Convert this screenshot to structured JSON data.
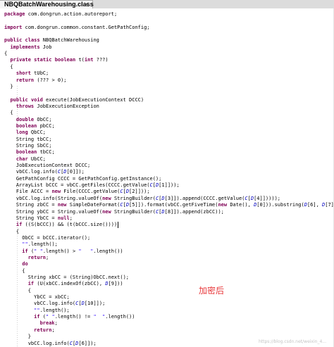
{
  "tab": {
    "title": "NBQBatchWarehousing.class",
    "close": "✕"
  },
  "code_lines": [
    "package com.dongrun.action.autoreport;",
    "",
    "import com.dongrun.common.constant.GetPathConfig;",
    "",
    "public class NBQBatchWarehousing",
    "  implements Job",
    "{",
    "  private static boolean t(int ???)",
    "  {",
    "    short tUbC;",
    "    return (??? > 0);",
    "  }",
    "",
    "  public void execute(JobExecutionContext DCCC)",
    "    throws JobExecutionException",
    "  {",
    "    double ObCC;",
    "    boolean pbCC;",
    "    long QbCC;",
    "    String tbCC;",
    "    String SbCC;",
    "    boolean tbCC;",
    "    char UbCC;",
    "    JobExecutionContext DCCC;",
    "    vbCC.log.info(C[D[0]]);",
    "    GetPathConfig CCCC = GetPathConfig.getInstance();",
    "    ArrayList bCCC = vbCC.getFiles(CCCC.getValue(C[D[1]]));",
    "    File ACCC = new File(CCCC.getValue(C[D[2]]));",
    "    vbCC.log.info(String.valueOf(new StringBuilder(C[D[3]]).append(CCCC.getValue(C[D[4]]))));",
    "    String zbCC = new SimpleDateFormat(C[D[5]]).format(vbCC.getFiveTime(new Date(), D[0])).substring(D[6], D[7]);",
    "    String ybCC = String.valueOf(new StringBuilder(C[D[8]]).append(zbCC));",
    "    String YbCC = null;",
    "    if ((S(bCCC)) && (t(bCCC.size())))",
    "    {",
    "      ObCC = bCCC.iterator();",
    "      \"\".length();",
    "      if (\" \".length() > \"   \".length())",
    "        return;",
    "      do",
    "      {",
    "        String xbCC = (String)ObCC.next();",
    "        if (U(xbCC.indexOf(zbCC), D[9]))",
    "        {",
    "          YbCC = xbCC;",
    "          vbCC.log.info(C[D[10]]);",
    "          \"\".length();",
    "          if (\" \".length() != \"  \".length())",
    "            break;",
    "          return;",
    "        }",
    "        vbCC.log.info(C[D[6]]);"
  ],
  "annotation": "加密后",
  "watermark": "https://blog.csdn.net/weixin_4..."
}
